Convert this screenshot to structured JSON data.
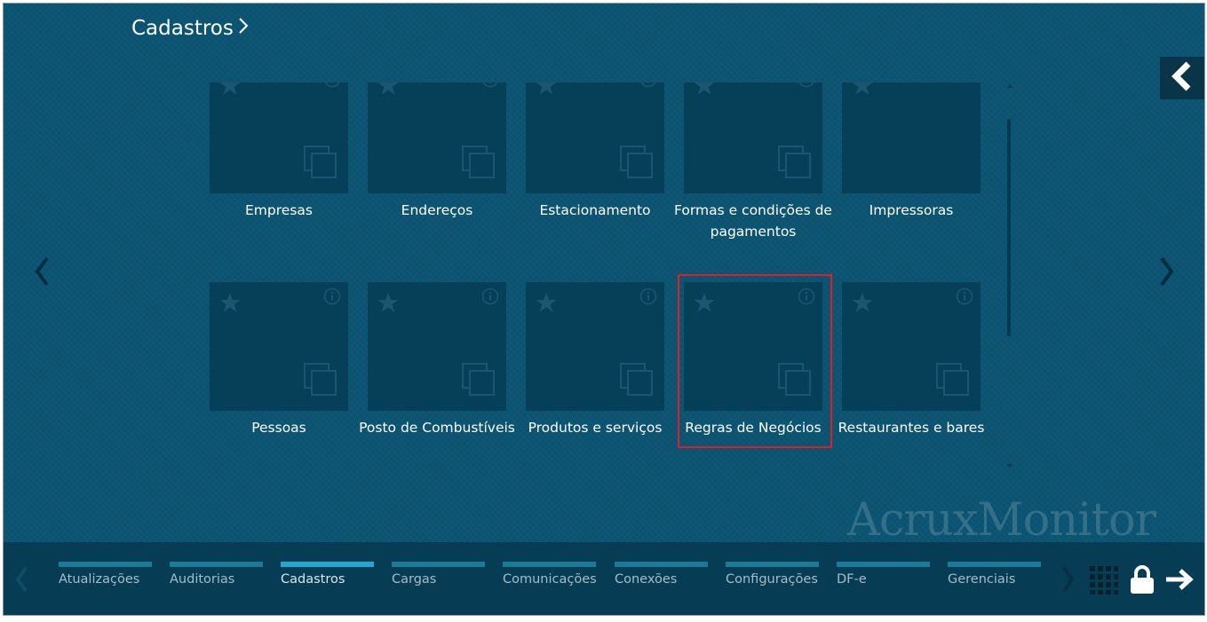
{
  "header": {
    "breadcrumb": "Cadastros"
  },
  "tiles": [
    {
      "label": "Empresas"
    },
    {
      "label": "Endereços"
    },
    {
      "label": "Estacionamento"
    },
    {
      "label": "Formas e condições de pagamentos"
    },
    {
      "label": "Impressoras"
    },
    {
      "label": "Pessoas"
    },
    {
      "label": "Posto de Combustíveis"
    },
    {
      "label": "Produtos e serviços"
    },
    {
      "label": "Regras de Negócios"
    },
    {
      "label": "Restaurantes e bares"
    }
  ],
  "watermark": "AcruxMonitor",
  "tabs": [
    {
      "label": "Atualizações"
    },
    {
      "label": "Auditorias"
    },
    {
      "label": "Cadastros",
      "active": true
    },
    {
      "label": "Cargas"
    },
    {
      "label": "Comunicações"
    },
    {
      "label": "Conexões"
    },
    {
      "label": "Configurações"
    },
    {
      "label": "DF-e"
    },
    {
      "label": "Gerenciais"
    }
  ],
  "icons": {
    "back": "chevron-left-icon",
    "prev_page": "chevron-left-icon",
    "next_page": "chevron-right-icon",
    "favorite": "star-icon",
    "info": "info-icon",
    "open": "copy-icon",
    "apps": "grid-icon",
    "lock": "lock-icon",
    "exit": "arrow-right-icon"
  },
  "colors": {
    "background": "#0b5472",
    "tile": "#063f58",
    "bottom_bar": "#063c54",
    "highlight": "#e01e26",
    "active_tab": "#22a8d0"
  }
}
